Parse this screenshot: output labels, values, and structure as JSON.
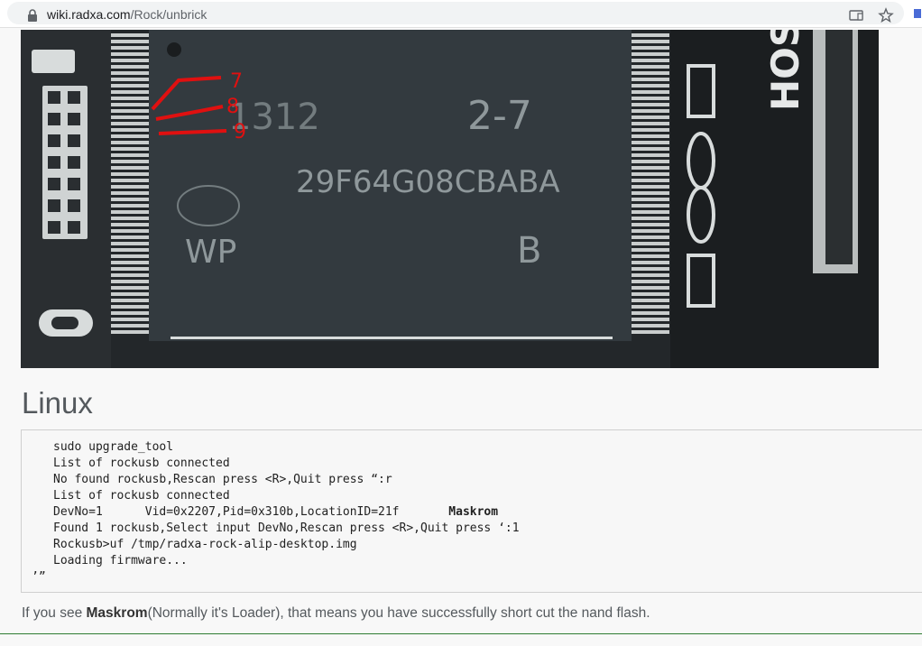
{
  "browser": {
    "url_host": "wiki.radxa.com",
    "url_path": "/Rock/unbrick",
    "icons": [
      "lock-icon",
      "cast-icon",
      "star-icon",
      "extension-icon"
    ]
  },
  "photo": {
    "alt": "NAND flash chip with pins 7, 8, 9 marked",
    "pin_labels": [
      "7",
      "8",
      "9"
    ],
    "chip_markings": [
      "2-7",
      "29F64G08CBABA",
      "WP",
      "B",
      "1312"
    ],
    "board_label": "HOST"
  },
  "section": {
    "heading": "Linux"
  },
  "code_lines": [
    "sudo upgrade_tool",
    "List of rockusb connected",
    "No found rockusb,Rescan press <R>,Quit press “:r",
    "List of rockusb connected",
    {
      "pre": "DevNo=1      Vid=0x2207,Pid=0x310b,LocationID=21f       ",
      "bold": "Maskrom"
    },
    "Found 1 rockusb,Select input DevNo,Rescan press <R>,Quit press ‘:1",
    "Rockusb>uf /tmp/radxa-rock-alip-desktop.img",
    "Loading firmware..."
  ],
  "code_tail": "’”",
  "paragraph": {
    "before": "If you see ",
    "bold": "Maskrom",
    "after": "(Normally it's Loader), that means you have successfully short cut the nand flash."
  },
  "colors": {
    "accent_rule": "#2e7d32",
    "pin_marker": "#e01010"
  }
}
